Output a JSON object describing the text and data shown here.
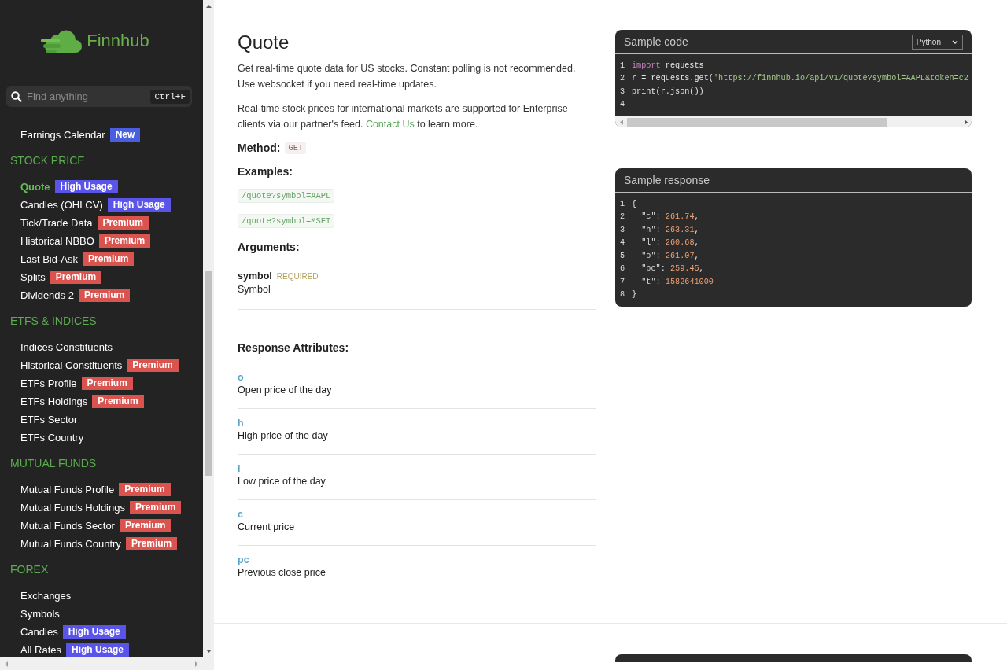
{
  "logo": {
    "text": "Finnhub"
  },
  "search": {
    "placeholder": "Find anything",
    "shortcut": "Ctrl+F"
  },
  "sidebar": {
    "sections": [
      {
        "items": [
          {
            "label": "Earnings Calendar",
            "selected": false,
            "badge": {
              "text": "New",
              "color": "#4a5fe0"
            }
          }
        ]
      },
      {
        "heading": "STOCK PRICE",
        "items": [
          {
            "label": "Quote",
            "selected": true,
            "badge": {
              "text": "High Usage",
              "color": "#5b54e8"
            }
          },
          {
            "label": "Candles (OHLCV)",
            "selected": false,
            "badge": {
              "text": "High Usage",
              "color": "#5b54e8"
            }
          },
          {
            "label": "Tick/Trade Data",
            "selected": false,
            "badge": {
              "text": "Premium",
              "color": "#d9534f"
            }
          },
          {
            "label": "Historical NBBO",
            "selected": false,
            "badge": {
              "text": "Premium",
              "color": "#d9534f"
            }
          },
          {
            "label": "Last Bid-Ask",
            "selected": false,
            "badge": {
              "text": "Premium",
              "color": "#d9534f"
            }
          },
          {
            "label": "Splits",
            "selected": false,
            "badge": {
              "text": "Premium",
              "color": "#d9534f"
            }
          },
          {
            "label": "Dividends 2",
            "selected": false,
            "badge": {
              "text": "Premium",
              "color": "#d9534f"
            }
          }
        ]
      },
      {
        "heading": "ETFS & INDICES",
        "items": [
          {
            "label": "Indices Constituents",
            "selected": false
          },
          {
            "label": "Historical Constituents",
            "selected": false,
            "badge": {
              "text": "Premium",
              "color": "#d9534f"
            }
          },
          {
            "label": "ETFs Profile",
            "selected": false,
            "badge": {
              "text": "Premium",
              "color": "#d9534f"
            }
          },
          {
            "label": "ETFs Holdings",
            "selected": false,
            "badge": {
              "text": "Premium",
              "color": "#d9534f"
            }
          },
          {
            "label": "ETFs Sector",
            "selected": false
          },
          {
            "label": "ETFs Country",
            "selected": false
          }
        ]
      },
      {
        "heading": "MUTUAL FUNDS",
        "items": [
          {
            "label": "Mutual Funds Profile",
            "selected": false,
            "badge": {
              "text": "Premium",
              "color": "#d9534f"
            }
          },
          {
            "label": "Mutual Funds Holdings",
            "selected": false,
            "badge": {
              "text": "Premium",
              "color": "#d9534f"
            }
          },
          {
            "label": "Mutual Funds Sector",
            "selected": false,
            "badge": {
              "text": "Premium",
              "color": "#d9534f"
            }
          },
          {
            "label": "Mutual Funds Country",
            "selected": false,
            "badge": {
              "text": "Premium",
              "color": "#d9534f"
            }
          }
        ]
      },
      {
        "heading": "FOREX",
        "items": [
          {
            "label": "Exchanges",
            "selected": false
          },
          {
            "label": "Symbols",
            "selected": false
          },
          {
            "label": "Candles",
            "selected": false,
            "badge": {
              "text": "High Usage",
              "color": "#5b54e8"
            }
          },
          {
            "label": "All Rates",
            "selected": false,
            "badge": {
              "text": "High Usage",
              "color": "#5b54e8"
            }
          }
        ]
      }
    ]
  },
  "doc": {
    "title": "Quote",
    "paragraphs": [
      {
        "text_before": "Get real-time quote data for US stocks. Constant polling is not recommended. Use websocket if you need real-time updates."
      },
      {
        "text_before": "Real-time stock prices for international markets are supported for Enterprise clients via our partner's feed. ",
        "link": "Contact Us",
        "text_after": " to learn more."
      }
    ],
    "method": {
      "label": "Method:",
      "value": "GET"
    },
    "examples": {
      "heading": "Examples:",
      "items": [
        "/quote?symbol=AAPL",
        "/quote?symbol=MSFT"
      ]
    },
    "arguments": {
      "heading": "Arguments:",
      "items": [
        {
          "name": "symbol",
          "tag": "REQUIRED",
          "description": "Symbol"
        }
      ]
    },
    "response": {
      "heading": "Response Attributes:",
      "items": [
        {
          "name": "o",
          "description": "Open price of the day"
        },
        {
          "name": "h",
          "description": "High price of the day"
        },
        {
          "name": "l",
          "description": "Low price of the day"
        },
        {
          "name": "c",
          "description": "Current price"
        },
        {
          "name": "pc",
          "description": "Previous close price"
        }
      ]
    }
  },
  "code_cards": [
    {
      "title": "Sample code",
      "language": "Python",
      "scrollbar": true,
      "lines": [
        {
          "number": "1",
          "tokens": [
            {
              "kind": "keyword",
              "text": "import"
            },
            {
              "kind": "plain",
              "text": " requests"
            }
          ]
        },
        {
          "number": "2",
          "tokens": [
            {
              "kind": "plain",
              "text": "r = requests.get("
            },
            {
              "kind": "string",
              "text": "'https://finnhub.io/api/v1/quote?symbol=AAPL&token=c2"
            }
          ]
        },
        {
          "number": "3",
          "tokens": [
            {
              "kind": "plain",
              "text": "print(r.json())"
            }
          ]
        },
        {
          "number": "4"
        }
      ]
    },
    {
      "title": "Sample response",
      "scrollbar": false,
      "lines": [
        {
          "number": "1",
          "tokens": [
            {
              "kind": "plain",
              "text": "{"
            }
          ]
        },
        {
          "number": "2",
          "tokens": [
            {
              "kind": "key",
              "text": "  \"c\""
            },
            {
              "kind": "plain",
              "text": ": "
            },
            {
              "kind": "number",
              "text": "261.74"
            },
            {
              "kind": "plain",
              "text": ","
            }
          ]
        },
        {
          "number": "3",
          "tokens": [
            {
              "kind": "key",
              "text": "  \"h\""
            },
            {
              "kind": "plain",
              "text": ": "
            },
            {
              "kind": "number",
              "text": "263.31"
            },
            {
              "kind": "plain",
              "text": ","
            }
          ]
        },
        {
          "number": "4",
          "tokens": [
            {
              "kind": "key",
              "text": "  \"l\""
            },
            {
              "kind": "plain",
              "text": ": "
            },
            {
              "kind": "number",
              "text": "260.68"
            },
            {
              "kind": "plain",
              "text": ","
            }
          ]
        },
        {
          "number": "5",
          "tokens": [
            {
              "kind": "key",
              "text": "  \"o\""
            },
            {
              "kind": "plain",
              "text": ": "
            },
            {
              "kind": "number",
              "text": "261.07"
            },
            {
              "kind": "plain",
              "text": ","
            }
          ]
        },
        {
          "number": "6",
          "tokens": [
            {
              "kind": "key",
              "text": "  \"pc\""
            },
            {
              "kind": "plain",
              "text": ": "
            },
            {
              "kind": "number",
              "text": "259.45"
            },
            {
              "kind": "plain",
              "text": ","
            }
          ]
        },
        {
          "number": "7",
          "tokens": [
            {
              "kind": "key",
              "text": "  \"t\""
            },
            {
              "kind": "plain",
              "text": ": "
            },
            {
              "kind": "number",
              "text": "1582641000"
            }
          ]
        },
        {
          "number": "8",
          "tokens": [
            {
              "kind": "plain",
              "text": "}"
            }
          ]
        }
      ]
    }
  ]
}
